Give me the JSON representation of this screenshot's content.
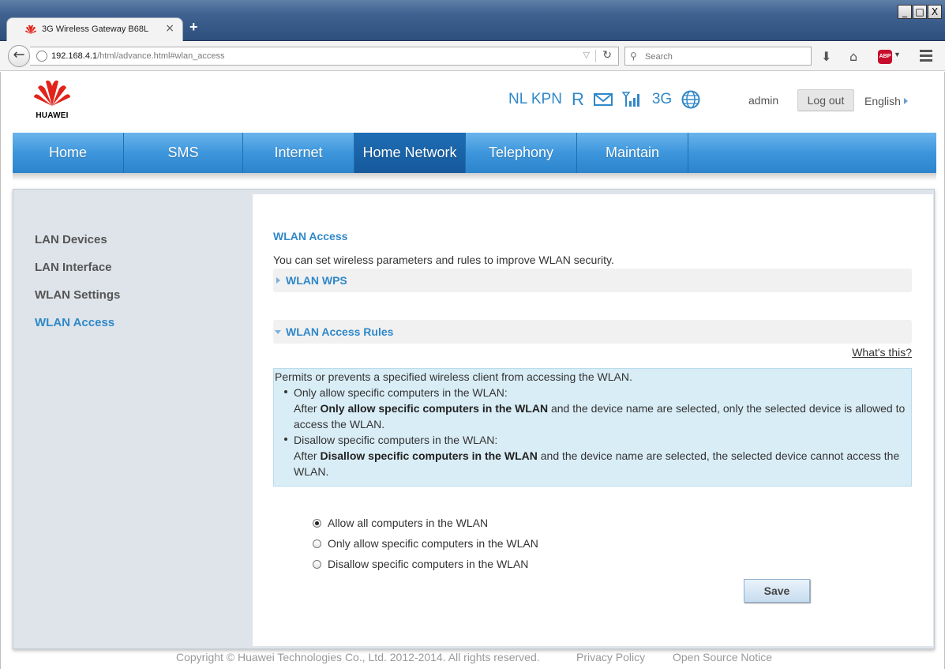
{
  "browser": {
    "tab_title": "3G Wireless Gateway B68L",
    "tab_close": "×",
    "new_tab": "+",
    "url_host": "192.168.4.1",
    "url_path": "/html/advance.html#wlan_access",
    "search_placeholder": "Search",
    "window_buttons": [
      "_",
      "□",
      "X"
    ]
  },
  "header": {
    "logo_text": "HUAWEI",
    "operator": "NL KPN",
    "roaming": "R",
    "network_type": "3G",
    "user": "admin",
    "logout_label": "Log out",
    "language": "English"
  },
  "nav": {
    "items": [
      {
        "label": "Home"
      },
      {
        "label": "SMS"
      },
      {
        "label": "Internet"
      },
      {
        "label": "Home Network"
      },
      {
        "label": "Telephony"
      },
      {
        "label": "Maintain"
      }
    ],
    "active": "Home Network"
  },
  "sidebar": {
    "items": [
      {
        "label": "LAN Devices"
      },
      {
        "label": "LAN Interface"
      },
      {
        "label": "WLAN Settings"
      },
      {
        "label": "WLAN Access"
      }
    ],
    "active": "WLAN Access"
  },
  "main": {
    "title": "WLAN Access",
    "description": "You can set wireless parameters and rules to improve WLAN security.",
    "section_wps": "WLAN WPS",
    "section_rules": "WLAN Access Rules",
    "whats_this": "What's this?",
    "help": {
      "intro": "Permits or prevents a specified wireless client from accessing the WLAN.",
      "item1_title": "Only allow specific computers in the WLAN:",
      "item1_pre": "After ",
      "item1_bold": "Only allow specific computers in the WLAN",
      "item1_post": " and the device name are selected, only the selected device is allowed to access the WLAN.",
      "item2_title": "Disallow specific computers in the WLAN:",
      "item2_pre": "After ",
      "item2_bold": "Disallow specific computers in the WLAN",
      "item2_post": " and the device name are selected, the selected device cannot access the WLAN."
    },
    "options": [
      {
        "label": "Allow all computers in the WLAN",
        "checked": true
      },
      {
        "label": "Only allow specific computers in the WLAN",
        "checked": false
      },
      {
        "label": "Disallow specific computers in the WLAN",
        "checked": false
      }
    ],
    "save_label": "Save"
  },
  "footer": {
    "copyright": "Copyright © Huawei Technologies Co., Ltd. 2012-2014. All rights reserved.",
    "privacy": "Privacy Policy",
    "open_source": "Open Source Notice"
  },
  "colors": {
    "accent": "#2f88c9",
    "nav_blue": "#3d96dc",
    "nav_active": "#1a63a8",
    "help_bg": "#d9edf6",
    "brand_red": "#e2231a"
  }
}
